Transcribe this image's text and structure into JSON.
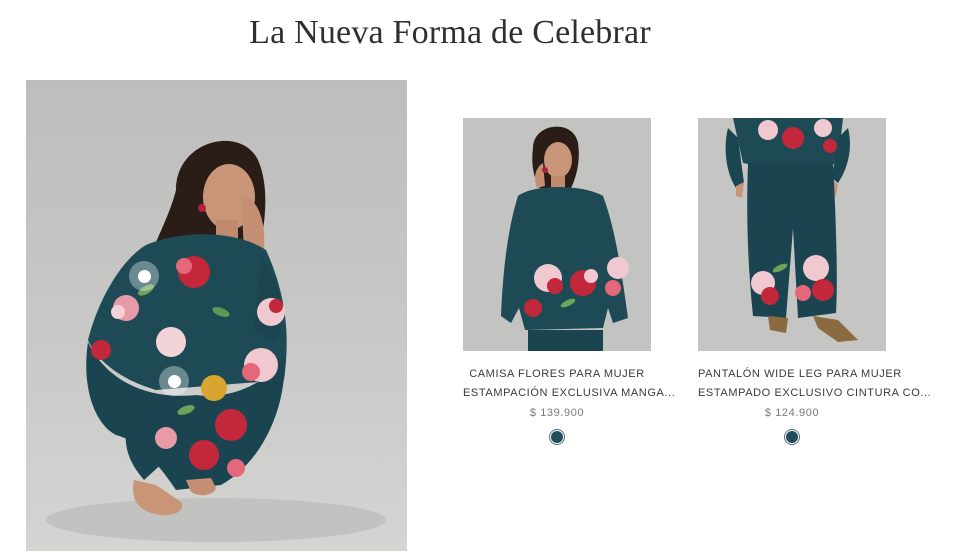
{
  "section": {
    "title": "La Nueva Forma de Celebrar"
  },
  "hero": {
    "hotspots": [
      {
        "label": ""
      },
      {
        "label": ""
      }
    ]
  },
  "products": [
    {
      "name_line1": "CAMISA FLORES PARA MUJER",
      "name_line2": "ESTAMPACIÓN EXCLUSIVA MANGA...",
      "price": "$ 139.900",
      "swatch_color": "#1f4f5c"
    },
    {
      "name_line1": "PANTALÓN WIDE LEG PARA MUJER",
      "name_line2": "ESTAMPADO EXCLUSIVO CINTURA CO...",
      "price": "$ 124.900",
      "swatch_color": "#1f4f5c"
    }
  ],
  "colors": {
    "garment_teal": "#1d4a55",
    "flower_red": "#c2283a",
    "flower_pink": "#e88a9a",
    "background_gray": "#c4c4c2"
  }
}
